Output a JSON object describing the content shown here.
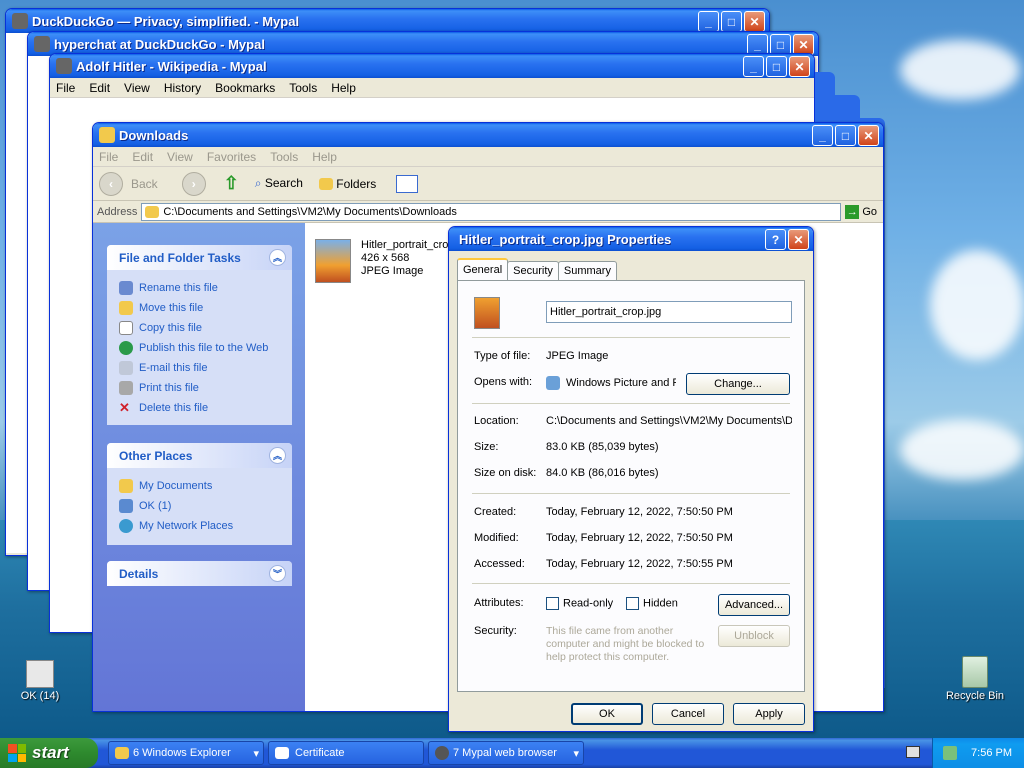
{
  "windows": [
    {
      "title": "DuckDuckGo — Privacy, simplified. - Mypal"
    },
    {
      "title": "hyperchat at DuckDuckGo - Mypal"
    },
    {
      "title": "Adolf Hitler - Wikipedia - Mypal"
    }
  ],
  "browser_menu": [
    "File",
    "Edit",
    "View",
    "History",
    "Bookmarks",
    "Tools",
    "Help"
  ],
  "explorer": {
    "title": "Downloads",
    "menu": [
      "File",
      "Edit",
      "View",
      "Favorites",
      "Tools",
      "Help"
    ],
    "toolbar": {
      "back": "Back",
      "search": "Search",
      "folders": "Folders"
    },
    "address_label": "Address",
    "address": "C:\\Documents and Settings\\VM2\\My Documents\\Downloads",
    "go": "Go",
    "file_tasks": {
      "header": "File and Folder Tasks",
      "items": [
        "Rename this file",
        "Move this file",
        "Copy this file",
        "Publish this file to the Web",
        "E-mail this file",
        "Print this file",
        "Delete this file"
      ]
    },
    "other_places": {
      "header": "Other Places",
      "items": [
        "My Documents",
        "OK (1)",
        "My Network Places"
      ]
    },
    "details": {
      "header": "Details"
    },
    "file": {
      "name": "Hitler_portrait_cro",
      "dims": "426 x 568",
      "type": "JPEG Image"
    }
  },
  "dialog": {
    "title": "Hitler_portrait_crop.jpg Properties",
    "tabs": [
      "General",
      "Security",
      "Summary"
    ],
    "filename": "Hitler_portrait_crop.jpg",
    "type_label": "Type of file:",
    "type_value": "JPEG Image",
    "opens_label": "Opens with:",
    "opens_value": "Windows Picture and F",
    "change": "Change...",
    "location_label": "Location:",
    "location_value": "C:\\Documents and Settings\\VM2\\My Documents\\D",
    "size_label": "Size:",
    "size_value": "83.0 KB (85,039 bytes)",
    "disk_label": "Size on disk:",
    "disk_value": "84.0 KB (86,016 bytes)",
    "created_label": "Created:",
    "created_value": "Today, February 12, 2022, 7:50:50 PM",
    "modified_label": "Modified:",
    "modified_value": "Today, February 12, 2022, 7:50:50 PM",
    "accessed_label": "Accessed:",
    "accessed_value": "Today, February 12, 2022, 7:50:55 PM",
    "attributes_label": "Attributes:",
    "readonly": "Read-only",
    "hidden": "Hidden",
    "advanced": "Advanced...",
    "security_label": "Security:",
    "security_text": "This file came from another computer and might be blocked to help protect this computer.",
    "unblock": "Unblock",
    "ok": "OK",
    "cancel": "Cancel",
    "apply": "Apply"
  },
  "desktop": {
    "ok_icon": "OK (14)",
    "recycle": "Recycle Bin"
  },
  "taskbar": {
    "start": "start",
    "items": [
      "6  Windows Explorer",
      "Certificate",
      "7  Mypal web browser"
    ],
    "clock": "7:56 PM"
  }
}
